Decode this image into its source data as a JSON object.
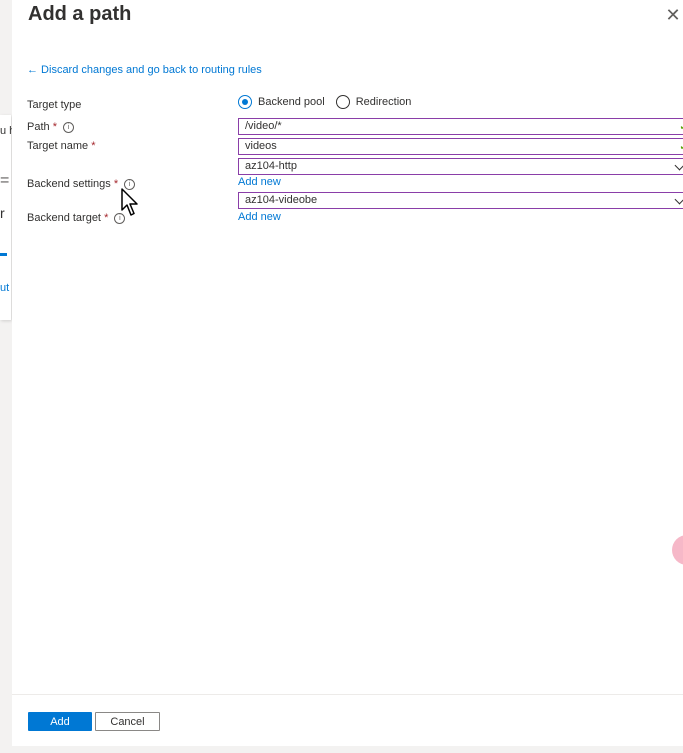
{
  "background": {
    "fragments": [
      "u h",
      "=",
      "r",
      "ut"
    ]
  },
  "panel": {
    "title": "Add a path",
    "close_icon": "close-icon",
    "back_link": "← Discard changes and go back to routing rules"
  },
  "form": {
    "target_type": {
      "label": "Target type",
      "options": [
        {
          "label": "Backend pool",
          "selected": true
        },
        {
          "label": "Redirection",
          "selected": false
        }
      ]
    },
    "path": {
      "label": "Path",
      "value": "/video/*",
      "valid": true
    },
    "target_name": {
      "label": "Target name",
      "value": "videos",
      "valid": true
    },
    "backend_settings": {
      "label": "Backend settings",
      "value": "az104-http",
      "add_new": "Add new"
    },
    "backend_target": {
      "label": "Backend target",
      "value": "az104-videobe",
      "add_new": "Add new"
    }
  },
  "footer": {
    "add_label": "Add",
    "cancel_label": "Cancel"
  },
  "colors": {
    "accent": "#0078d4",
    "required": "#a4262c",
    "field_border": "#8a3ea8",
    "valid": "#57a300"
  }
}
